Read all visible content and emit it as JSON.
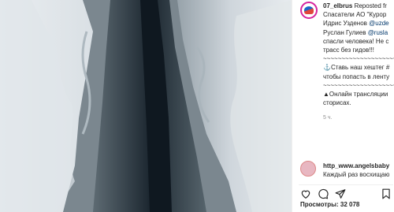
{
  "post": {
    "username": "07_elbrus",
    "caption_lines": [
      " Reposted fr",
      "Спасатели АО \"Курор",
      "Идрис Узденов ",
      "Руслан Гулиев ",
      "спасли человека! Не с",
      "трасс без гидов!!!",
      "~~~~~~~~~~~~~~~~~~~~",
      "⚓Ставь наш хештег #",
      "чтобы попасть в ленту",
      "~~~~~~~~~~~~~~~~~~~~",
      "▲Онлайн трансляции",
      "сторисах."
    ],
    "mention_1": "@uzde",
    "mention_2": "@rusla",
    "timestamp": "5 ч.",
    "comment_username": "http_www.angelsbaby",
    "comment_text": "Каждый раз восхищаю",
    "views_label": "Просмотры:",
    "views_count": "32 078",
    "icons": {
      "like": "heart-icon",
      "comment": "comment-icon",
      "share": "share-icon",
      "save": "bookmark-icon"
    }
  }
}
